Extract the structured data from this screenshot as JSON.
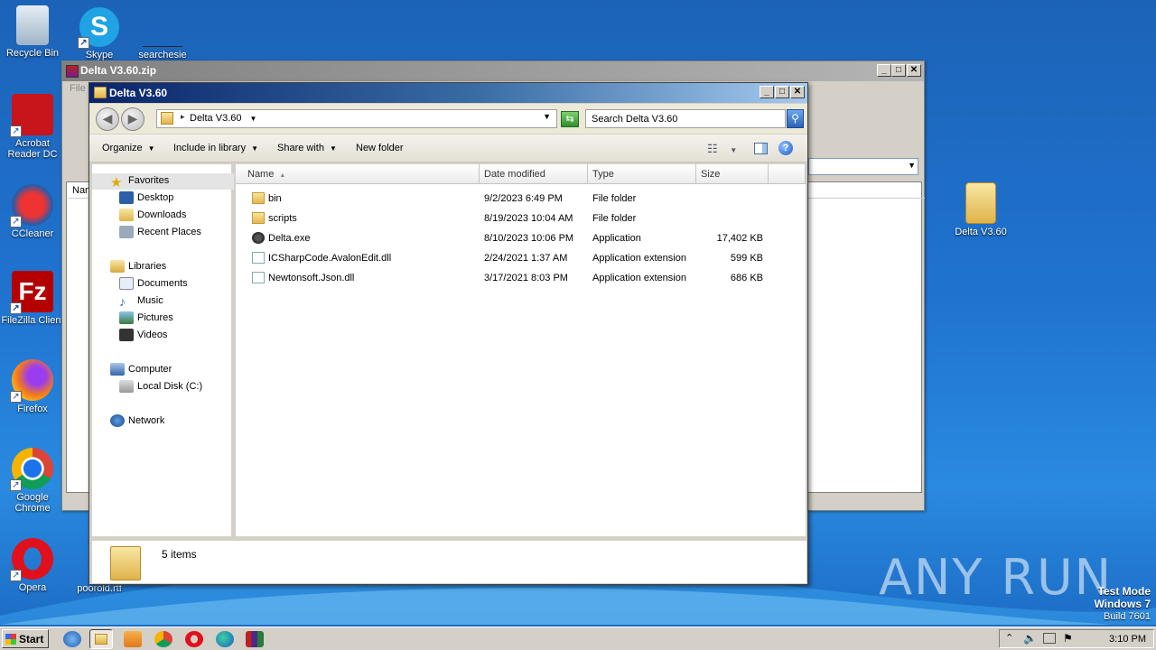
{
  "desktop": {
    "icons": [
      {
        "label": "Recycle Bin"
      },
      {
        "label": "Skype"
      },
      {
        "label": "searchesie"
      },
      {
        "label": "Acrobat Reader DC"
      },
      {
        "label": "CCleaner"
      },
      {
        "label": "FileZilla Client"
      },
      {
        "label": "Firefox"
      },
      {
        "label": "Google Chrome"
      },
      {
        "label": "Opera"
      },
      {
        "label": "poorold.rtf"
      },
      {
        "label": "Delta V3.60"
      }
    ],
    "watermark": "ANY RUN",
    "test_mode": [
      "Test Mode",
      "Windows 7",
      "Build 7601"
    ]
  },
  "winrar": {
    "title": "Delta V3.60.zip",
    "menu_first": "File",
    "column_first": "Nam"
  },
  "explorer": {
    "title": "Delta V3.60",
    "address": "Delta V3.60",
    "search_placeholder": "Search Delta V3.60",
    "toolbar": {
      "organize": "Organize",
      "include": "Include in library",
      "share": "Share with",
      "new_folder": "New folder"
    },
    "nav": {
      "favorites": "Favorites",
      "desktop": "Desktop",
      "downloads": "Downloads",
      "recent": "Recent Places",
      "libraries": "Libraries",
      "documents": "Documents",
      "music": "Music",
      "pictures": "Pictures",
      "videos": "Videos",
      "computer": "Computer",
      "local_disk": "Local Disk (C:)",
      "network": "Network"
    },
    "columns": [
      "Name",
      "Date modified",
      "Type",
      "Size"
    ],
    "files": [
      {
        "name": "bin",
        "date": "9/2/2023 6:49 PM",
        "type": "File folder",
        "size": "",
        "kind": "folder"
      },
      {
        "name": "scripts",
        "date": "8/19/2023 10:04 AM",
        "type": "File folder",
        "size": "",
        "kind": "folder"
      },
      {
        "name": "Delta.exe",
        "date": "8/10/2023 10:06 PM",
        "type": "Application",
        "size": "17,402 KB",
        "kind": "exe"
      },
      {
        "name": "ICSharpCode.AvalonEdit.dll",
        "date": "2/24/2021 1:37 AM",
        "type": "Application extension",
        "size": "599 KB",
        "kind": "dll"
      },
      {
        "name": "Newtonsoft.Json.dll",
        "date": "3/17/2021 8:03 PM",
        "type": "Application extension",
        "size": "686 KB",
        "kind": "dll"
      }
    ],
    "details": "5 items"
  },
  "taskbar": {
    "start": "Start",
    "clock": "3:10 PM"
  }
}
